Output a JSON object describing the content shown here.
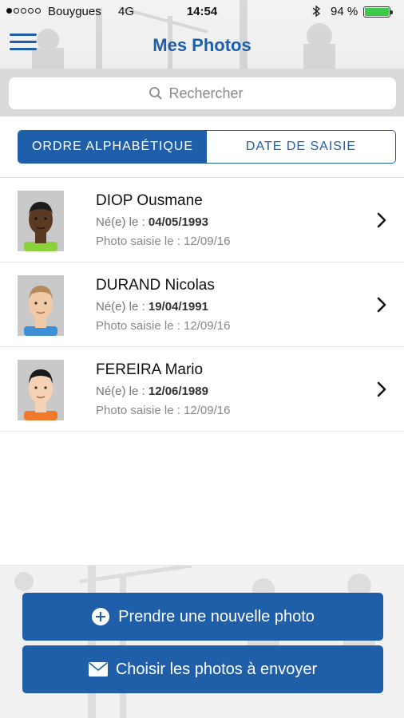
{
  "status_bar": {
    "carrier": "Bouygues",
    "network": "4G",
    "time": "14:54",
    "battery": "94 %"
  },
  "header": {
    "title": "Mes Photos"
  },
  "search": {
    "placeholder": "Rechercher"
  },
  "segments": [
    {
      "label": "ORDRE ALPHABÉTIQUE",
      "selected": true
    },
    {
      "label": "DATE DE SAISIE",
      "selected": false
    }
  ],
  "people": [
    {
      "name": "DIOP Ousmane",
      "birth_label": "Né(e) le : ",
      "birth_date": "04/05/1993",
      "saisie": "Photo saisie le : 12/09/16"
    },
    {
      "name": "DURAND Nicolas",
      "birth_label": "Né(e) le : ",
      "birth_date": "19/04/1991",
      "saisie": "Photo saisie le : 12/09/16"
    },
    {
      "name": "FEREIRA Mario",
      "birth_label": "Né(e) le : ",
      "birth_date": "12/06/1989",
      "saisie": "Photo saisie le : 12/09/16"
    }
  ],
  "actions": {
    "new_photo": "Prendre une nouvelle photo",
    "choose_photos": "Choisir les photos à envoyer"
  },
  "colors": {
    "primary": "#1f5ea8",
    "battery": "#3cc84a"
  }
}
